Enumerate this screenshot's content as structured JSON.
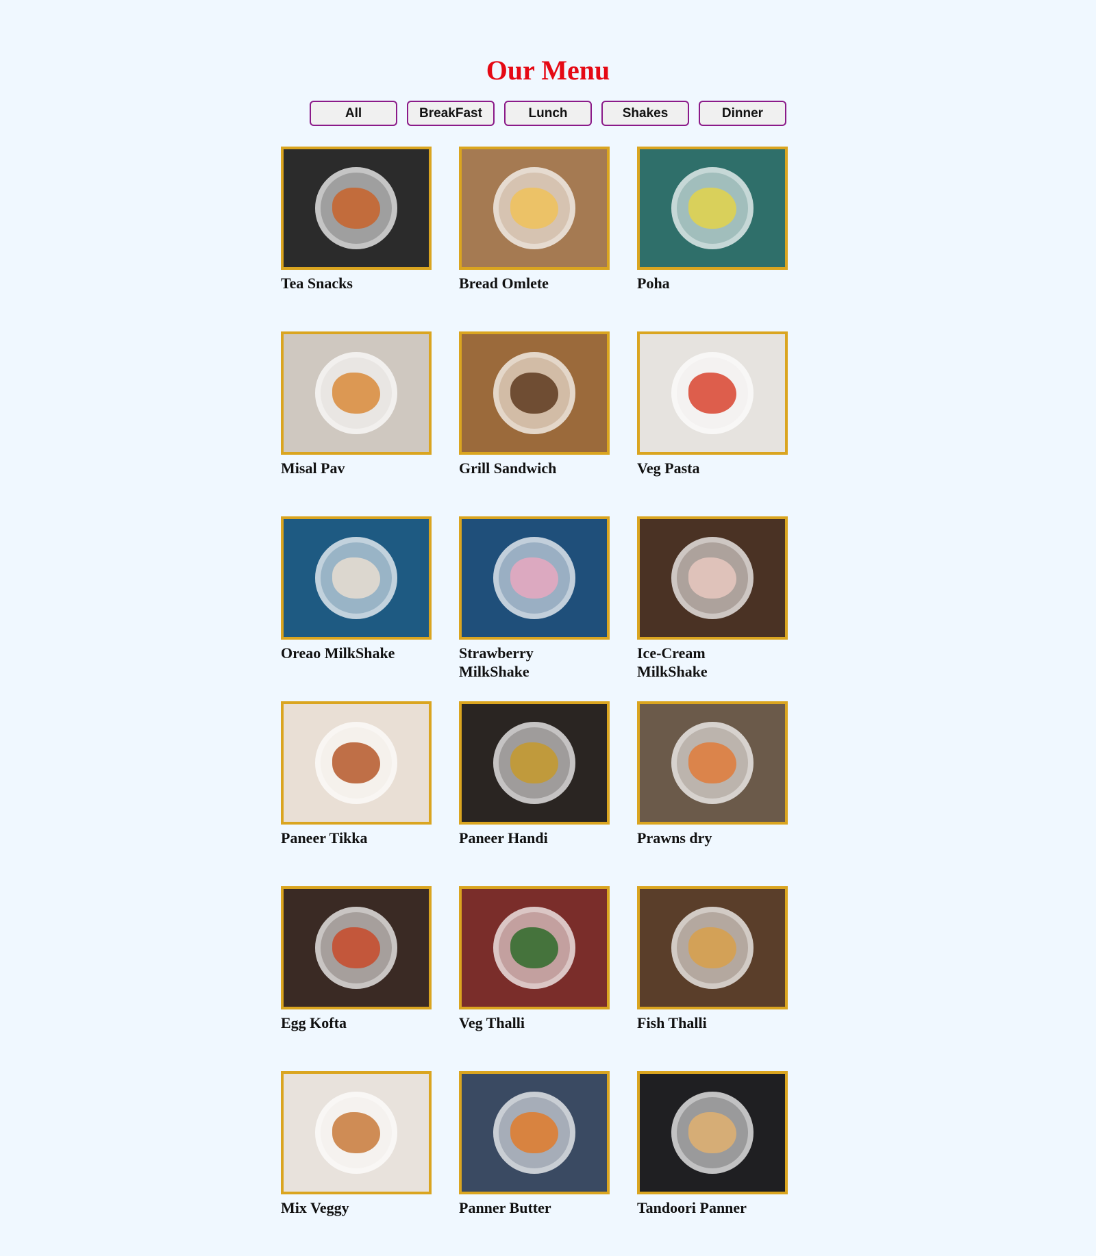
{
  "header": {
    "title": "Our Menu"
  },
  "filters": [
    {
      "label": "All"
    },
    {
      "label": "BreakFast"
    },
    {
      "label": "Lunch"
    },
    {
      "label": "Shakes"
    },
    {
      "label": "Dinner"
    }
  ],
  "menu": [
    {
      "name": "Tea Snacks",
      "bg": "#2b2b2b",
      "food": "#c8632a"
    },
    {
      "name": "Bread Omlete",
      "bg": "#a57a52",
      "food": "#f0c25a"
    },
    {
      "name": "Poha",
      "bg": "#2f6f6a",
      "food": "#e3d34a"
    },
    {
      "name": "Misal Pav",
      "bg": "#cfc8c0",
      "food": "#d98a3a"
    },
    {
      "name": "Grill Sandwich",
      "bg": "#9b6a3b",
      "food": "#5e3a1e"
    },
    {
      "name": "Veg Pasta",
      "bg": "#e6e3df",
      "food": "#d8442f"
    },
    {
      "name": "Oreao MilkShake",
      "bg": "#1e5a82",
      "food": "#e8ddd0"
    },
    {
      "name": "Strawberry MilkShake",
      "bg": "#1f4f7a",
      "food": "#e7a8bf"
    },
    {
      "name": "Ice-Cream MilkShake",
      "bg": "#4a3224",
      "food": "#e7c8c0"
    },
    {
      "name": "Paneer Tikka",
      "bg": "#e9dfd5",
      "food": "#b5582a"
    },
    {
      "name": "Paneer Handi",
      "bg": "#2a2522",
      "food": "#c59a2c"
    },
    {
      "name": "Prawns dry",
      "bg": "#6b5a4a",
      "food": "#e07b3a"
    },
    {
      "name": "Egg Kofta",
      "bg": "#3a2a24",
      "food": "#c84a2a"
    },
    {
      "name": "Veg Thalli",
      "bg": "#7a2d2a",
      "food": "#2f6b2a"
    },
    {
      "name": "Fish Thalli",
      "bg": "#5a3e2a",
      "food": "#d8a04a"
    },
    {
      "name": "Mix Veggy",
      "bg": "#e8e2dc",
      "food": "#c87a3a"
    },
    {
      "name": "Panner Butter",
      "bg": "#3a4a62",
      "food": "#e07b2a"
    },
    {
      "name": "Tandoori Panner",
      "bg": "#1f1f22",
      "food": "#e0b070"
    }
  ]
}
